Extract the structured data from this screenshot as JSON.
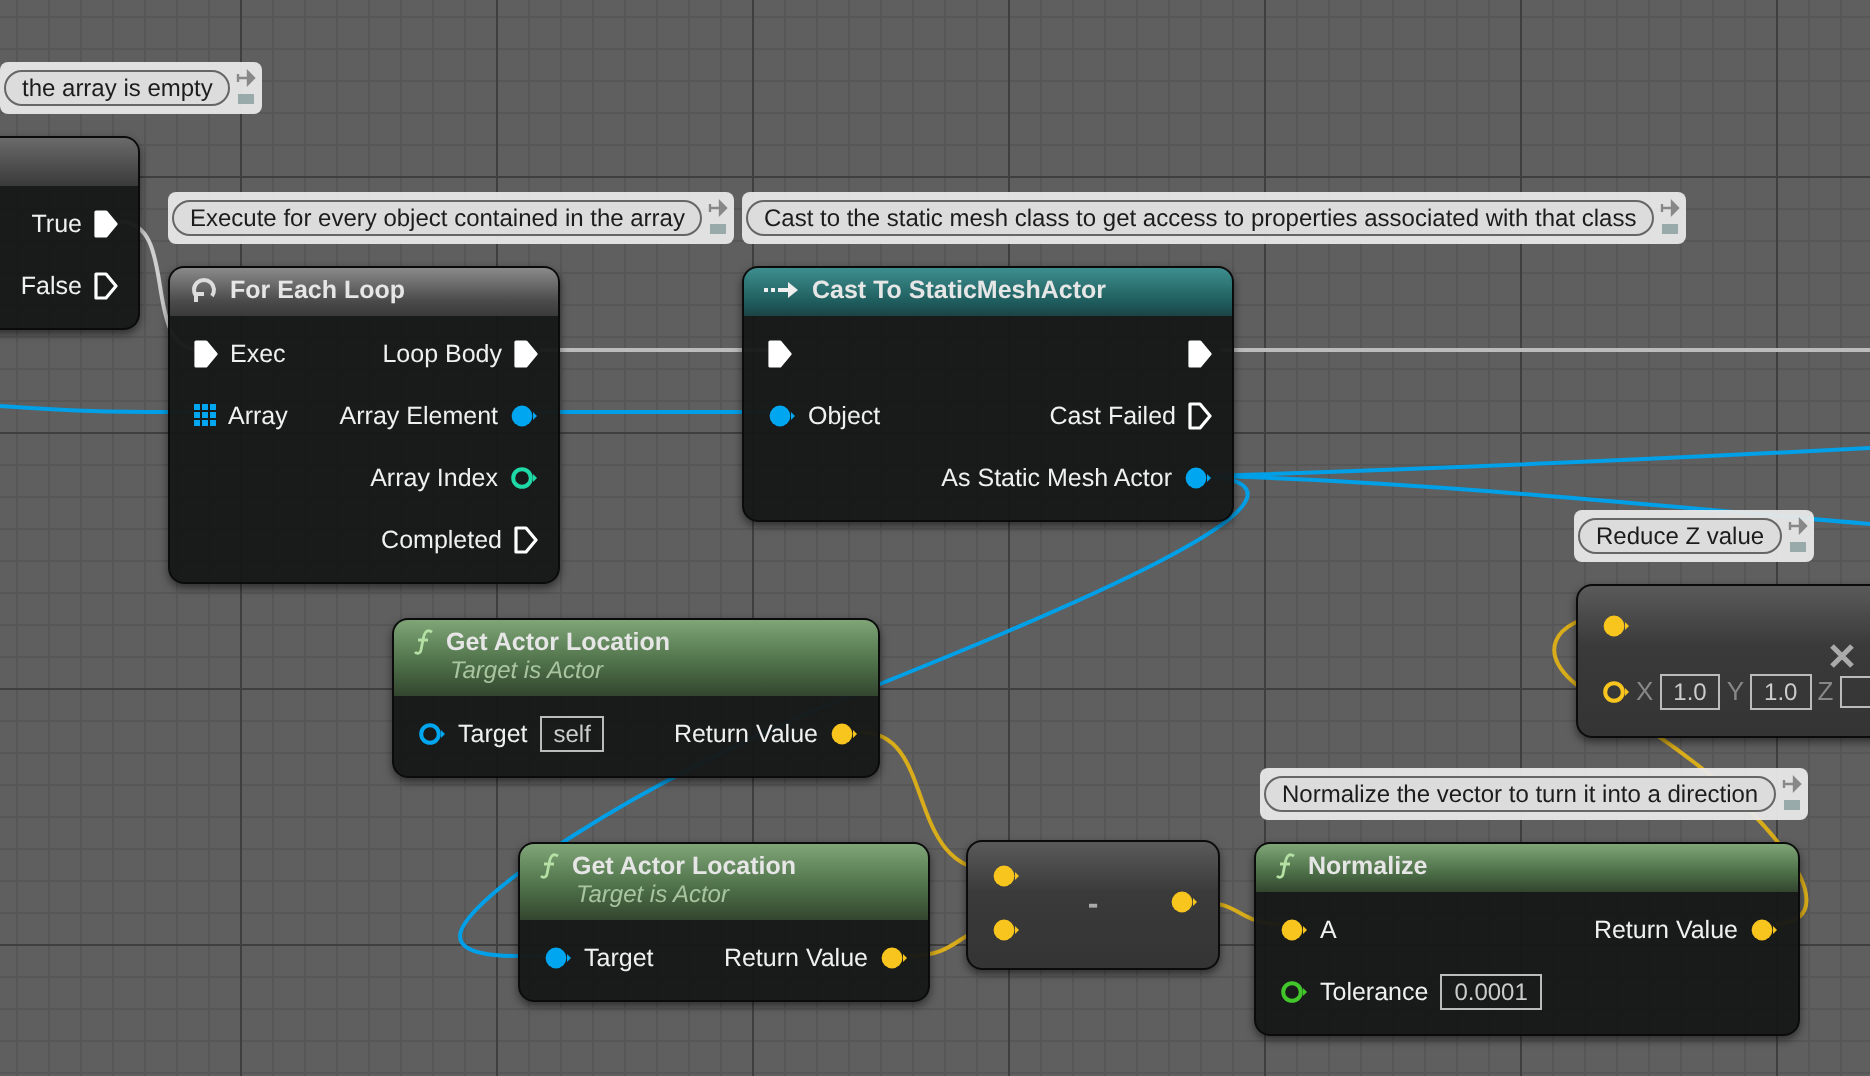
{
  "nodes": [
    {
      "kind": "branch",
      "comment": "the array is empty",
      "outputs": [
        {
          "kind": "exec",
          "label": "True",
          "connected": true
        },
        {
          "kind": "exec",
          "label": "False",
          "connected": false
        }
      ]
    },
    {
      "kind": "loop",
      "title": "For Each Loop",
      "comment": "Execute for every object contained in the array",
      "inputs": [
        {
          "kind": "exec",
          "label": "Exec",
          "connected": true
        },
        {
          "kind": "array",
          "label": "Array",
          "connected": true
        }
      ],
      "outputs": [
        {
          "kind": "exec",
          "label": "Loop Body",
          "connected": true
        },
        {
          "kind": "object",
          "label": "Array Element",
          "connected": true
        },
        {
          "kind": "int",
          "label": "Array Index",
          "connected": false
        },
        {
          "kind": "exec",
          "label": "Completed",
          "connected": false
        }
      ]
    },
    {
      "kind": "cast",
      "title": "Cast To StaticMeshActor",
      "comment": "Cast to the static mesh class to get access to properties associated with that class",
      "inputs": [
        {
          "kind": "exec",
          "connected": true
        },
        {
          "kind": "object",
          "label": "Object",
          "connected": true
        }
      ],
      "outputs": [
        {
          "kind": "exec",
          "connected": true
        },
        {
          "kind": "exec",
          "label": "Cast Failed",
          "connected": false
        },
        {
          "kind": "object",
          "label": "As Static Mesh Actor",
          "connected": true
        }
      ]
    },
    {
      "kind": "multiply",
      "comment": "Reduce Z value",
      "inputs": [
        {
          "kind": "vector",
          "connected": true
        },
        {
          "kind": "vector",
          "connected": false,
          "components": [
            {
              "label": "X",
              "value": "1.0"
            },
            {
              "label": "Y",
              "value": "1.0"
            },
            {
              "label": "Z"
            }
          ]
        }
      ]
    },
    {
      "kind": "function",
      "title": "Get Actor Location",
      "subtitle": "Target is Actor",
      "inputs": [
        {
          "kind": "object",
          "label": "Target",
          "value": "self",
          "connected": false
        }
      ],
      "outputs": [
        {
          "kind": "vector",
          "label": "Return Value",
          "connected": true
        }
      ]
    },
    {
      "kind": "function",
      "title": "Get Actor Location",
      "subtitle": "Target is Actor",
      "inputs": [
        {
          "kind": "object",
          "label": "Target",
          "connected": true
        }
      ],
      "outputs": [
        {
          "kind": "vector",
          "label": "Return Value",
          "connected": true
        }
      ]
    },
    {
      "kind": "operator",
      "symbol": "-",
      "inputs": [
        {
          "kind": "vector",
          "connected": true
        },
        {
          "kind": "vector",
          "connected": true
        }
      ],
      "outputs": [
        {
          "kind": "vector",
          "connected": true
        }
      ]
    },
    {
      "kind": "function",
      "title": "Normalize",
      "comment": "Normalize the vector to turn it into a direction",
      "inputs": [
        {
          "kind": "vector",
          "label": "A",
          "connected": true
        },
        {
          "kind": "float",
          "label": "Tolerance",
          "value": "0.0001",
          "connected": false
        }
      ],
      "outputs": [
        {
          "kind": "vector",
          "label": "Return Value",
          "connected": true
        }
      ]
    }
  ]
}
